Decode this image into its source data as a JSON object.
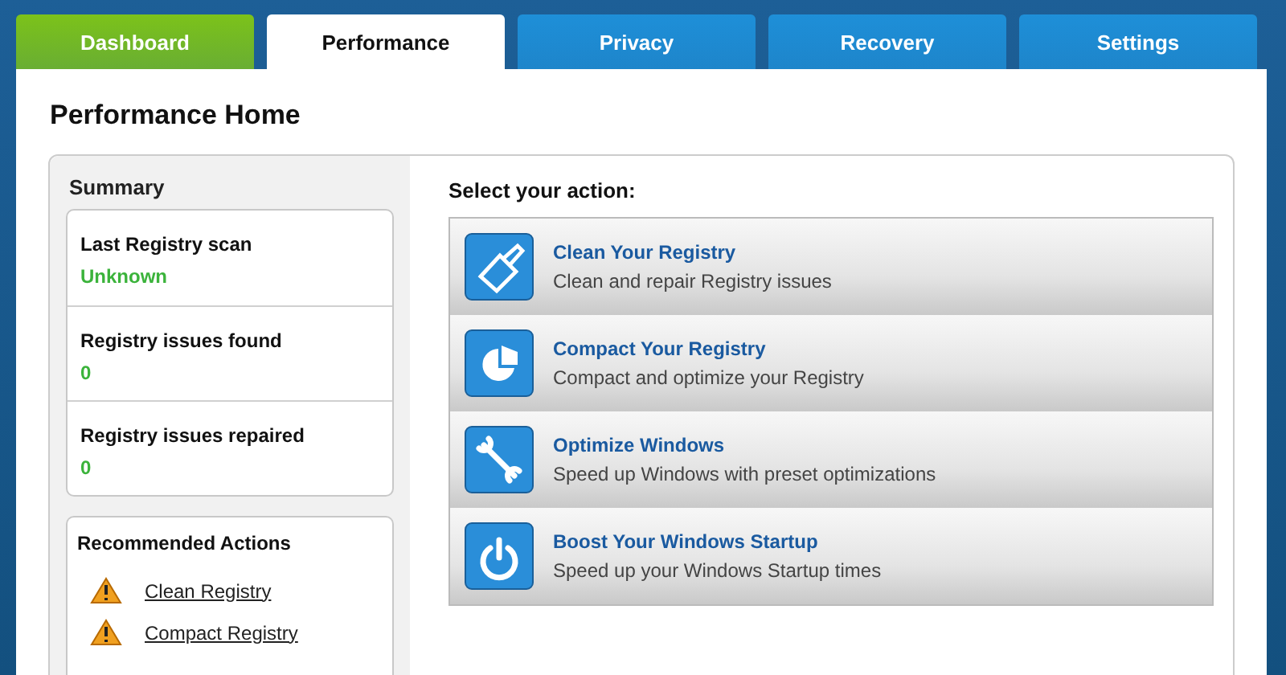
{
  "tabs": [
    {
      "label": "Dashboard",
      "selected": false,
      "color": "#7cc21a"
    },
    {
      "label": "Performance",
      "selected": true,
      "color": "#ffffff"
    },
    {
      "label": "Privacy",
      "selected": false,
      "color": "#1e8fd8"
    },
    {
      "label": "Recovery",
      "selected": false,
      "color": "#1e8fd8"
    },
    {
      "label": "Settings",
      "selected": false,
      "color": "#1e8fd8"
    }
  ],
  "page_title": "Performance Home",
  "summary": {
    "title": "Summary",
    "stats": [
      {
        "label": "Last Registry scan",
        "value": "Unknown"
      },
      {
        "label": "Registry issues found",
        "value": "0"
      },
      {
        "label": "Registry issues repaired",
        "value": "0"
      }
    ]
  },
  "recommended": {
    "title": "Recommended Actions",
    "links": [
      "Clean Registry",
      "Compact Registry"
    ]
  },
  "actions_title": "Select your action:",
  "actions": [
    {
      "kind": "brush",
      "title": "Clean Your Registry",
      "description": "Clean and repair Registry issues"
    },
    {
      "kind": "pie",
      "title": "Compact Your Registry",
      "description": "Compact and optimize your Registry"
    },
    {
      "kind": "wrench",
      "title": "Optimize Windows",
      "description": "Speed up Windows with preset optimizations"
    },
    {
      "kind": "power",
      "title": "Boost Your Windows Startup",
      "description": "Speed up your Windows Startup times"
    }
  ]
}
